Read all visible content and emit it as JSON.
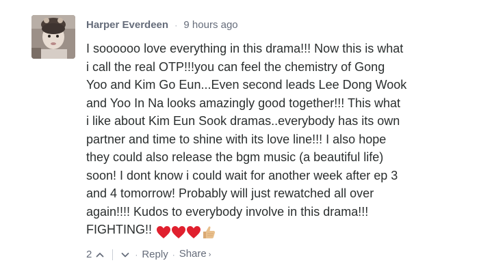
{
  "comment": {
    "author": "Harper Everdeen",
    "timestamp": "9 hours ago",
    "lines": [
      "I soooooo love everything in this drama!!! Now this is what",
      "i call the real OTP!!!you can feel the chemistry of Gong",
      "Yoo and Kim Go Eun...Even second leads Lee Dong Wook",
      "and Yoo In Na looks amazingly good together!!! This what",
      "i like about Kim Eun Sook dramas..everybody has its own",
      "partner and time to shine with its love line!!! I also hope",
      "they could also release the bgm music (a beautiful life)",
      "soon! I dont know i could wait for another week after ep 3",
      "and 4 tomorrow! Probably will just rewatched all over",
      "again!!!! Kudos to everybody involve in this drama!!!",
      "FIGHTING!!"
    ],
    "emojis": [
      "red-heart-icon",
      "red-heart-icon",
      "red-heart-icon",
      "thumbs-up-icon"
    ],
    "upvotes": "2",
    "actions": {
      "reply": "Reply",
      "share": "Share",
      "separator": "·"
    }
  },
  "colors": {
    "meta_text": "#656c7a",
    "body_text": "#2a2e2e",
    "heart": "#e0202e",
    "thumb": "#e9c08d"
  }
}
